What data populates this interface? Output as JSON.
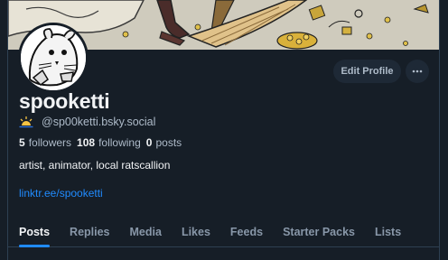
{
  "profile": {
    "display_name": "spooketti",
    "handle": "@sp00ketti.bsky.social",
    "handle_emoji": "sunrise-icon",
    "bio": "artist, animator, local ratscallion",
    "link": "linktr.ee/spooketti"
  },
  "stats": {
    "followers_count": "5",
    "followers_label": "followers",
    "following_count": "108",
    "following_label": "following",
    "posts_count": "0",
    "posts_label": "posts"
  },
  "actions": {
    "edit_profile": "Edit Profile",
    "more_icon": "ellipsis-icon"
  },
  "tabs": [
    {
      "label": "Posts",
      "active": true
    },
    {
      "label": "Replies"
    },
    {
      "label": "Media"
    },
    {
      "label": "Likes"
    },
    {
      "label": "Feeds"
    },
    {
      "label": "Starter Packs"
    },
    {
      "label": "Lists"
    }
  ],
  "colors": {
    "background": "#161e27",
    "accent": "#208bfe",
    "muted_text": "#aebbc9",
    "button_bg": "#1e2936"
  }
}
